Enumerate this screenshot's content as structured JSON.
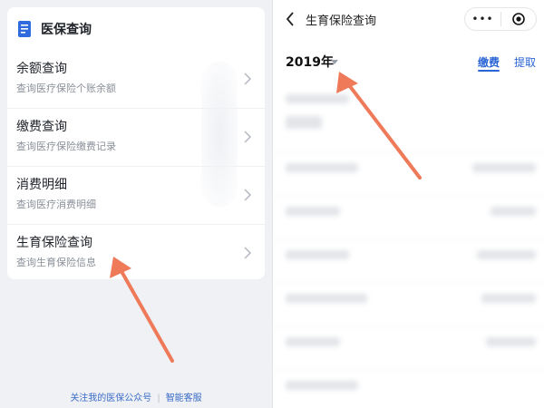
{
  "left_panel": {
    "card_title": "医保查询",
    "items": [
      {
        "title": "余额查询",
        "subtitle": "查询医疗保险个账余额"
      },
      {
        "title": "缴费查询",
        "subtitle": "查询医疗保险缴费记录"
      },
      {
        "title": "消费明细",
        "subtitle": "查询医疗消费明细"
      },
      {
        "title": "生育保险查询",
        "subtitle": "查询生育保险信息"
      }
    ],
    "footer": {
      "follow_label": "关注我的医保公众号",
      "separator": "|",
      "service_label": "智能客服"
    }
  },
  "right_panel": {
    "nav_title": "生育保险查询",
    "capsule_more": "•••",
    "year": "2019年",
    "tabs": [
      {
        "label": "缴费",
        "active": true
      },
      {
        "label": "提取",
        "active": false
      }
    ]
  },
  "colors": {
    "accent_blue": "#2a64d6",
    "annotation_arrow": "#ee7a5a",
    "doc_icon_blue": "#2f6bdc"
  },
  "icons": {
    "card_header": "document-icon",
    "item_chevron": "chevron-right-icon",
    "nav_back": "back-arrow-icon",
    "capsule_close": "target-circle-icon",
    "year_dropdown": "caret-down-icon"
  }
}
